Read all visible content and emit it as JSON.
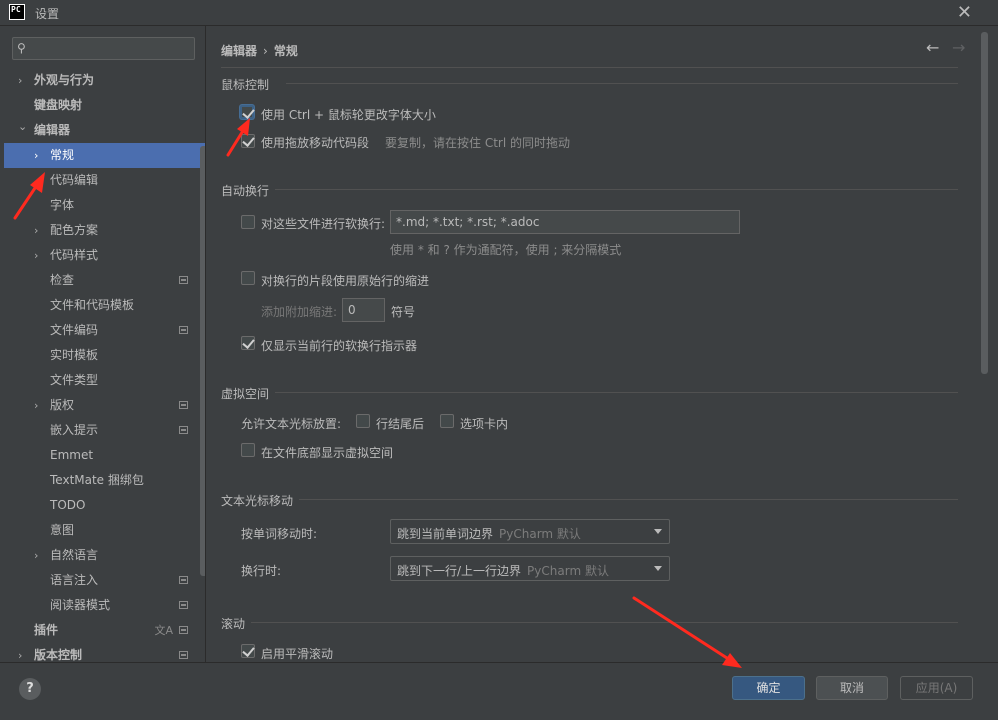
{
  "window": {
    "title": "设置",
    "logo_line1": "PC",
    "logo_line2": ""
  },
  "search": {
    "placeholder": "",
    "value": ""
  },
  "sidebar": {
    "items": [
      {
        "label": "外观与行为",
        "expandable": true,
        "level": 0
      },
      {
        "label": "键盘映射",
        "expandable": false,
        "level": 0
      },
      {
        "label": "编辑器",
        "expandable": true,
        "expanded": true,
        "level": 0
      },
      {
        "label": "常规",
        "expandable": true,
        "level": 1,
        "selected": true
      },
      {
        "label": "代码编辑",
        "level": 1
      },
      {
        "label": "字体",
        "level": 1
      },
      {
        "label": "配色方案",
        "expandable": true,
        "level": 1
      },
      {
        "label": "代码样式",
        "expandable": true,
        "level": 1
      },
      {
        "label": "检查",
        "level": 1,
        "badge": true
      },
      {
        "label": "文件和代码模板",
        "level": 1
      },
      {
        "label": "文件编码",
        "level": 1,
        "badge": true
      },
      {
        "label": "实时模板",
        "level": 1
      },
      {
        "label": "文件类型",
        "level": 1
      },
      {
        "label": "版权",
        "expandable": true,
        "level": 1,
        "badge": true
      },
      {
        "label": "嵌入提示",
        "level": 1,
        "badge": true
      },
      {
        "label": "Emmet",
        "level": 1
      },
      {
        "label": "TextMate 捆绑包",
        "level": 1
      },
      {
        "label": "TODO",
        "level": 1
      },
      {
        "label": "意图",
        "level": 1
      },
      {
        "label": "自然语言",
        "expandable": true,
        "level": 1
      },
      {
        "label": "语言注入",
        "level": 1,
        "badge": true
      },
      {
        "label": "阅读器模式",
        "level": 1,
        "badge": true
      },
      {
        "label": "插件",
        "level": 0,
        "badge": true,
        "lang": true
      },
      {
        "label": "版本控制",
        "expandable": true,
        "level": 0,
        "badge": true
      }
    ]
  },
  "breadcrumb": {
    "parent": "编辑器",
    "separator": "›",
    "current": "常规"
  },
  "sections": {
    "mouse": {
      "title": "鼠标控制",
      "ctrl_wheel_label": "使用 Ctrl + 鼠标轮更改字体大小",
      "ctrl_wheel_checked": true,
      "drag_move_label": "使用拖放移动代码段",
      "drag_move_checked": true,
      "drag_move_hint": "要复制，请在按住 Ctrl 的同时拖动"
    },
    "softwrap": {
      "title": "自动换行",
      "files_label": "对这些文件进行软换行:",
      "files_checked": false,
      "files_value": "*.md; *.txt; *.rst; *.adoc",
      "files_hint": "使用 * 和 ? 作为通配符，使用 ; 来分隔模式",
      "indent_label": "对换行的片段使用原始行的缩进",
      "indent_checked": false,
      "extra_indent_label": "添加附加缩进:",
      "extra_indent_value": "0",
      "extra_indent_unit": "符号",
      "current_line_label": "仅显示当前行的软换行指示器",
      "current_line_checked": true
    },
    "virtual": {
      "title": "虚拟空间",
      "allow_label": "允许文本光标放置:",
      "line_end_label": "行结尾后",
      "line_end_checked": false,
      "tab_label": "选项卡内",
      "tab_checked": false,
      "file_end_label": "在文件底部显示虚拟空间",
      "file_end_checked": false
    },
    "caret": {
      "title": "文本光标移动",
      "word_label": "按单词移动时:",
      "word_value": "跳到当前单词边界",
      "word_sub": "PyCharm 默认",
      "line_label": "换行时:",
      "line_value": "跳到下一行/上一行边界",
      "line_sub": "PyCharm 默认"
    },
    "scroll": {
      "title": "滚动",
      "smooth_label": "启用平滑滚动",
      "smooth_checked": true
    }
  },
  "footer": {
    "help": "?",
    "ok": "确定",
    "cancel": "取消",
    "apply": "应用(A)"
  },
  "colors": {
    "selection": "#4b6eaf",
    "primary_button": "#365880",
    "annotation_arrow": "#ff2a1f"
  }
}
